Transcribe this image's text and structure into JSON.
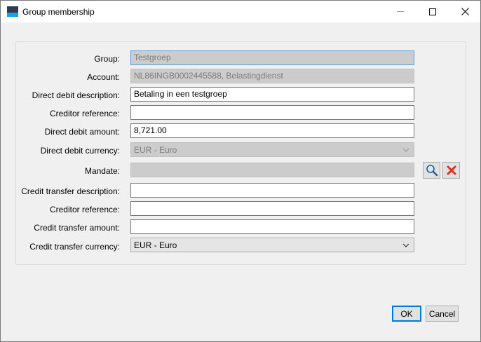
{
  "window": {
    "title": "Group membership"
  },
  "form": {
    "rows": [
      {
        "label": "Group:",
        "value": "Testgroep",
        "state": "disabled-focused"
      },
      {
        "label": "Account:",
        "value": "NL86INGB0002445588, Belastingdienst",
        "state": "disabled"
      },
      {
        "label": "Direct debit description:",
        "value": "Betaling in een testgroep",
        "state": "enabled"
      },
      {
        "label": "Creditor reference:",
        "value": "",
        "state": "enabled"
      },
      {
        "label": "Direct debit amount:",
        "value": "8,721.00",
        "state": "enabled"
      },
      {
        "label": "Direct debit currency:",
        "value": "EUR - Euro",
        "state": "disabled-select"
      },
      {
        "label": "Mandate:",
        "value": "",
        "state": "disabled"
      },
      {
        "label": "Credit transfer description:",
        "value": "",
        "state": "enabled"
      },
      {
        "label": "Creditor reference:",
        "value": "",
        "state": "enabled"
      },
      {
        "label": "Credit transfer amount:",
        "value": "",
        "state": "enabled"
      },
      {
        "label": "Credit transfer currency:",
        "value": "EUR - Euro",
        "state": "enabled-select"
      }
    ]
  },
  "mandate_buttons": {
    "search_icon": "magnifier-icon",
    "clear_icon": "red-x-icon"
  },
  "buttons": {
    "ok": "OK",
    "cancel": "Cancel"
  },
  "colors": {
    "accent": "#0078d7",
    "disabled_bg": "#cccccc",
    "clear_red": "#e0302a"
  }
}
